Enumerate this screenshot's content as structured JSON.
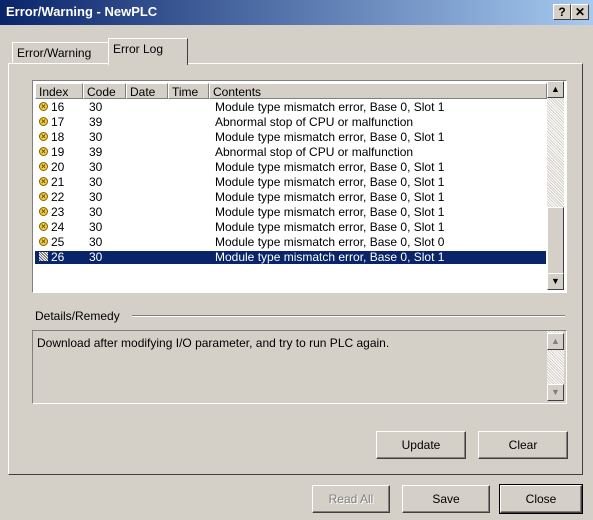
{
  "window": {
    "title": "Error/Warning - NewPLC",
    "help_label": "?",
    "close_label": "✕"
  },
  "tabs": [
    {
      "label": "Error/Warning",
      "active": false
    },
    {
      "label": "Error Log",
      "active": true
    }
  ],
  "table": {
    "columns": [
      "Index",
      "Code",
      "Date",
      "Time",
      "Contents"
    ],
    "rows": [
      {
        "index": "16",
        "code": "30",
        "date": "",
        "time": "",
        "contents": "Module type mismatch error, Base 0, Slot 1"
      },
      {
        "index": "17",
        "code": "39",
        "date": "",
        "time": "",
        "contents": "Abnormal stop of CPU or malfunction"
      },
      {
        "index": "18",
        "code": "30",
        "date": "",
        "time": "",
        "contents": "Module type mismatch error, Base 0, Slot 1"
      },
      {
        "index": "19",
        "code": "39",
        "date": "",
        "time": "",
        "contents": "Abnormal stop of CPU or malfunction"
      },
      {
        "index": "20",
        "code": "30",
        "date": "",
        "time": "",
        "contents": "Module type mismatch error, Base 0, Slot 1"
      },
      {
        "index": "21",
        "code": "30",
        "date": "",
        "time": "",
        "contents": "Module type mismatch error, Base 0, Slot 1"
      },
      {
        "index": "22",
        "code": "30",
        "date": "",
        "time": "",
        "contents": "Module type mismatch error, Base 0, Slot 1"
      },
      {
        "index": "23",
        "code": "30",
        "date": "",
        "time": "",
        "contents": "Module type mismatch error, Base 0, Slot 1"
      },
      {
        "index": "24",
        "code": "30",
        "date": "",
        "time": "",
        "contents": "Module type mismatch error, Base 0, Slot 1"
      },
      {
        "index": "25",
        "code": "30",
        "date": "",
        "time": "",
        "contents": "Module type mismatch error, Base 0, Slot 0"
      },
      {
        "index": "26",
        "code": "30",
        "date": "",
        "time": "",
        "contents": "Module type mismatch error, Base 0, Slot 1",
        "selected": true
      }
    ]
  },
  "details": {
    "label": "Details/Remedy",
    "text": "Download after modifying I/O parameter, and try to run PLC again."
  },
  "buttons": {
    "update": "Update",
    "clear": "Clear",
    "read_all": "Read All",
    "save": "Save",
    "close": "Close"
  },
  "colors": {
    "selection": "#0a246a",
    "titlebar_start": "#0a246a",
    "titlebar_end": "#a6caf0",
    "face": "#d4d0c8"
  }
}
